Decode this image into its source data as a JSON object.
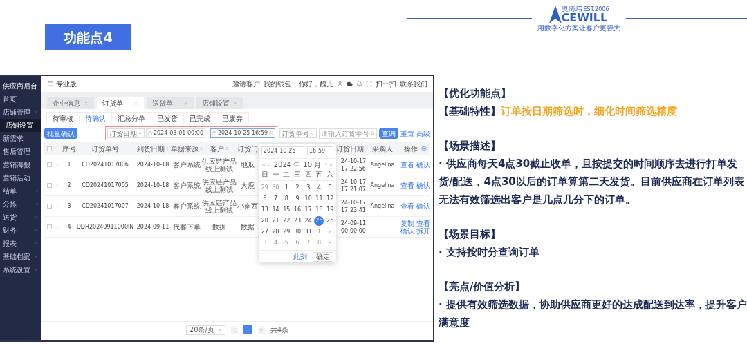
{
  "slide": {
    "title": "功能点4",
    "logo": {
      "name": "奥琦玮",
      "est": "EST.2006",
      "wordmark": "CEWILL",
      "tagline": "用数字化方案让客户更强大"
    }
  },
  "app": {
    "sidebar": {
      "title": "供应商后台",
      "items": [
        {
          "label": "首页",
          "selected": false
        },
        {
          "label": "店铺管理",
          "selected": false,
          "expanded": true,
          "children": [
            {
              "label": "店铺设置",
              "selected": true
            }
          ]
        },
        {
          "label": "新需求",
          "selected": false
        },
        {
          "label": "售后管理",
          "selected": false
        },
        {
          "label": "营销海报",
          "selected": false
        },
        {
          "label": "营销活动",
          "selected": false
        },
        {
          "label": "结单",
          "selected": false,
          "expanded": false
        },
        {
          "label": "分拣",
          "selected": false,
          "expanded": false
        },
        {
          "label": "送货",
          "selected": false,
          "expanded": false
        },
        {
          "label": "财务",
          "selected": false,
          "expanded": false
        },
        {
          "label": "报表",
          "selected": false,
          "expanded": false
        },
        {
          "label": "基础档案",
          "selected": false,
          "expanded": false
        },
        {
          "label": "系统设置",
          "selected": false,
          "expanded": false
        }
      ]
    },
    "topbar": {
      "title": "专业版",
      "links": [
        "邀请客户",
        "我的钱包"
      ],
      "greeting": "你好，魏儿",
      "scan": "扫一扫",
      "contact": "联系我们"
    },
    "page_tabs": [
      {
        "label": "企业信息",
        "selected": false
      },
      {
        "label": "订货单",
        "selected": true
      },
      {
        "label": "送货单",
        "selected": false
      },
      {
        "label": "店铺设置",
        "selected": false
      }
    ],
    "status_tabs": [
      {
        "label": "待审核",
        "selected": false
      },
      {
        "label": "待确认",
        "selected": true
      },
      {
        "label": "汇总分单",
        "selected": false
      },
      {
        "label": "已发货",
        "selected": false
      },
      {
        "label": "已完成",
        "selected": false
      },
      {
        "label": "已废弃",
        "selected": false
      }
    ],
    "toolbar": {
      "batch_button": "批量确认",
      "date_field": "订货日期",
      "date_start": "2024-03-01 00:00",
      "range_separator": "-",
      "date_end": "2024-10-25 16:59",
      "key_field": "订货单号",
      "key_placeholder": "请输入订货单号",
      "search_button": "查询",
      "reset_link": "重置",
      "advanced_link": "高级"
    },
    "table": {
      "all_checked": false,
      "columns": [
        {
          "label": "序号",
          "sortable": false
        },
        {
          "label": "订货单号",
          "sortable": false
        },
        {
          "label": "到货日期",
          "sortable": true
        },
        {
          "label": "单据来源",
          "sortable": true
        },
        {
          "label": "客户",
          "sortable": true
        },
        {
          "label": "订货门",
          "sortable": false
        },
        {
          "label": "订货日期",
          "sortable": true
        },
        {
          "label": "采购人",
          "sortable": false
        },
        {
          "label": "操作",
          "sortable": false
        }
      ],
      "rows": [
        {
          "checked": false,
          "cells": [
            "1",
            "CD20241017006",
            "2024-10-18",
            "客户系统",
            "供应链产品线上测试",
            "地瓜",
            "24-10-17 17:22:56",
            "Angelina"
          ],
          "actions": [
            "查看",
            "确认"
          ]
        },
        {
          "checked": false,
          "cells": [
            "2",
            "CD20241017005",
            "2024-10-18",
            "客户系统",
            "供应链产品线上测试",
            "大鹿",
            "24-10-17 17:21:07",
            "Angelina"
          ],
          "actions": [
            "查看",
            "确认"
          ]
        },
        {
          "checked": false,
          "cells": [
            "3",
            "CD20241017007",
            "2024-10-18",
            "客户系统",
            "供应链产品线上测试",
            "小南西",
            "24-10-17 17:23:41",
            "Angelina"
          ],
          "actions": [
            "查看",
            "确认"
          ]
        },
        {
          "checked": false,
          "cells": [
            "4",
            "DDH20240911000IN",
            "2024-09-11",
            "代客下单",
            "数据",
            "数据",
            "24-09-11 00:00:00"
          ],
          "actions": [
            "复制",
            "查看",
            "确认",
            "拆开"
          ]
        }
      ]
    },
    "calendar": {
      "date_value": "2024-10-25",
      "time_value": "16:59",
      "year": "2024 年",
      "month": "10 月",
      "weekdays": [
        "日",
        "一",
        "二",
        "三",
        "四",
        "五",
        "六"
      ],
      "days": [
        {
          "day": "29",
          "in_month": false,
          "selected": false
        },
        {
          "day": "30",
          "in_month": false,
          "selected": false
        },
        {
          "day": "1",
          "in_month": true,
          "selected": false
        },
        {
          "day": "2",
          "in_month": true,
          "selected": false
        },
        {
          "day": "3",
          "in_month": true,
          "selected": false
        },
        {
          "day": "4",
          "in_month": true,
          "selected": false
        },
        {
          "day": "5",
          "in_month": true,
          "selected": false
        },
        {
          "day": "6",
          "in_month": true,
          "selected": false
        },
        {
          "day": "7",
          "in_month": true,
          "selected": false
        },
        {
          "day": "8",
          "in_month": true,
          "selected": false
        },
        {
          "day": "9",
          "in_month": true,
          "selected": false
        },
        {
          "day": "10",
          "in_month": true,
          "selected": false
        },
        {
          "day": "11",
          "in_month": true,
          "selected": false
        },
        {
          "day": "12",
          "in_month": true,
          "selected": false
        },
        {
          "day": "13",
          "in_month": true,
          "selected": false
        },
        {
          "day": "14",
          "in_month": true,
          "selected": false
        },
        {
          "day": "15",
          "in_month": true,
          "selected": false
        },
        {
          "day": "16",
          "in_month": true,
          "selected": false
        },
        {
          "day": "17",
          "in_month": true,
          "selected": false
        },
        {
          "day": "18",
          "in_month": true,
          "selected": false
        },
        {
          "day": "19",
          "in_month": true,
          "selected": false
        },
        {
          "day": "20",
          "in_month": true,
          "selected": false
        },
        {
          "day": "21",
          "in_month": true,
          "selected": false
        },
        {
          "day": "22",
          "in_month": true,
          "selected": false
        },
        {
          "day": "23",
          "in_month": true,
          "selected": false
        },
        {
          "day": "24",
          "in_month": true,
          "selected": false
        },
        {
          "day": "25",
          "in_month": true,
          "selected": true
        },
        {
          "day": "26",
          "in_month": true,
          "selected": false
        },
        {
          "day": "27",
          "in_month": true,
          "selected": false
        },
        {
          "day": "28",
          "in_month": true,
          "selected": false
        },
        {
          "day": "29",
          "in_month": true,
          "selected": false
        },
        {
          "day": "30",
          "in_month": true,
          "selected": false
        },
        {
          "day": "31",
          "in_month": true,
          "selected": false
        },
        {
          "day": "1",
          "in_month": false,
          "selected": false
        },
        {
          "day": "2",
          "in_month": false,
          "selected": false
        },
        {
          "day": "3",
          "in_month": false,
          "selected": false
        },
        {
          "day": "4",
          "in_month": false,
          "selected": false
        },
        {
          "day": "5",
          "in_month": false,
          "selected": false
        },
        {
          "day": "6",
          "in_month": false,
          "selected": false
        },
        {
          "day": "7",
          "in_month": false,
          "selected": false
        },
        {
          "day": "8",
          "in_month": false,
          "selected": false
        },
        {
          "day": "9",
          "in_month": false,
          "selected": false
        }
      ],
      "now_button": "此刻",
      "ok_button": "确定"
    },
    "pagination": {
      "page_size": "20条/页",
      "pages": [
        {
          "label": "1",
          "selected": true
        }
      ],
      "total": "共4条"
    }
  },
  "notes": {
    "intro": [
      {
        "text": "【优化功能点】"
      },
      {
        "text": "【基础特性】",
        "highlight": "订单按日期筛选时，细化时间筛选精度"
      }
    ],
    "sections": [
      {
        "heading": "【场景描述】",
        "paragraphs": [
          "· 供应商每天4点30截止收单，且按提交的时间顺序去进行打单发货/配送，4点30以后的订单算第二天发货。目前供应商在订单列表无法有效筛选出客户是几点几分下的订单。"
        ]
      },
      {
        "heading": "【场景目标】",
        "paragraphs": [
          "· 支持按时分查询订单"
        ]
      },
      {
        "heading": "【亮点/价值分析】",
        "paragraphs": [
          "· 提供有效筛选数据，协助供应商更好的达成配送到达率，提升客户满意度"
        ]
      }
    ]
  }
}
